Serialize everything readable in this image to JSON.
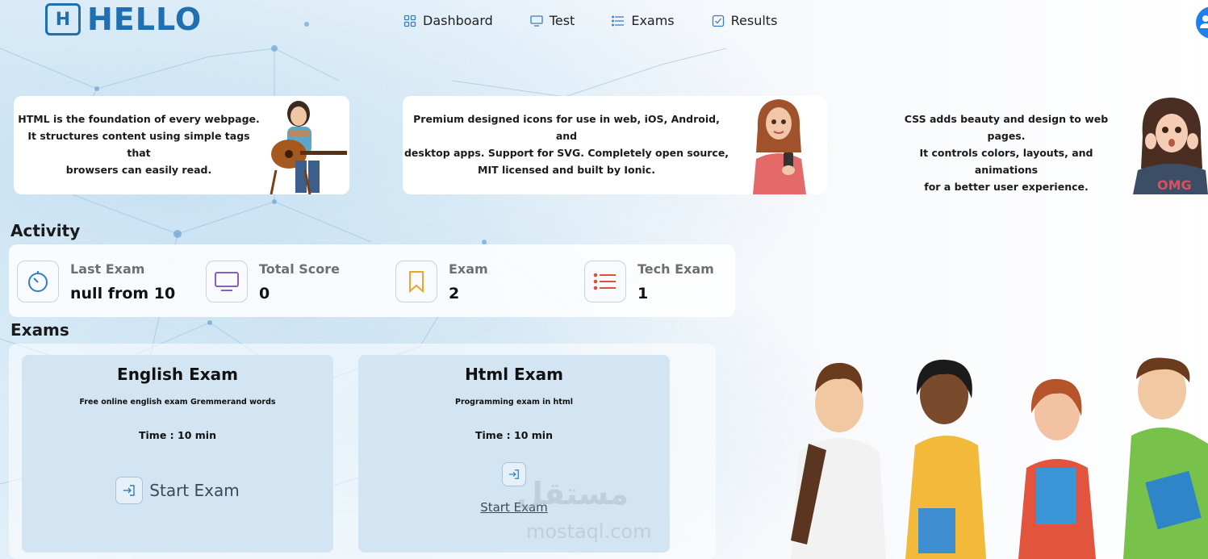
{
  "brand": {
    "logo_letter": "H",
    "name": "HELLO",
    "color": "#1f6fb2"
  },
  "nav": [
    {
      "label": "Dashboard",
      "icon": "grid-icon"
    },
    {
      "label": "Test",
      "icon": "monitor-icon"
    },
    {
      "label": "Exams",
      "icon": "list-icon"
    },
    {
      "label": "Results",
      "icon": "checkbox-icon"
    }
  ],
  "info_cards": [
    {
      "text": "HTML is the foundation of every webpage.\nIt structures content using simple tags that\nbrowsers can easily read."
    },
    {
      "text": "Premium designed icons for use in web, iOS, Android, and\ndesktop apps. Support for SVG. Completely open source,\nMIT licensed and built by Ionic."
    },
    {
      "text": "CSS adds beauty and design to web pages.\nIt controls colors, layouts, and animations\nfor a better user experience."
    }
  ],
  "activity": {
    "title": "Activity",
    "stats": [
      {
        "label": "Last Exam",
        "value": "null from 10",
        "icon": "timer-icon"
      },
      {
        "label": "Total Score",
        "value": "0",
        "icon": "monitor-icon"
      },
      {
        "label": "Exam",
        "value": "2",
        "icon": "bookmark-icon"
      },
      {
        "label": "Tech Exam",
        "value": "1",
        "icon": "list-icon"
      }
    ]
  },
  "exams": {
    "title": "Exams",
    "items": [
      {
        "title": "English Exam",
        "description": "Free online english exam Gremmerand words",
        "time": "Time : 10 min",
        "button": "Start Exam"
      },
      {
        "title": "Html Exam",
        "description": "Programming exam in html",
        "time": "Time : 10 min",
        "button": "Start Exam"
      }
    ]
  },
  "watermark": {
    "arabic": "مستقل",
    "latin": "mostaql.com"
  }
}
